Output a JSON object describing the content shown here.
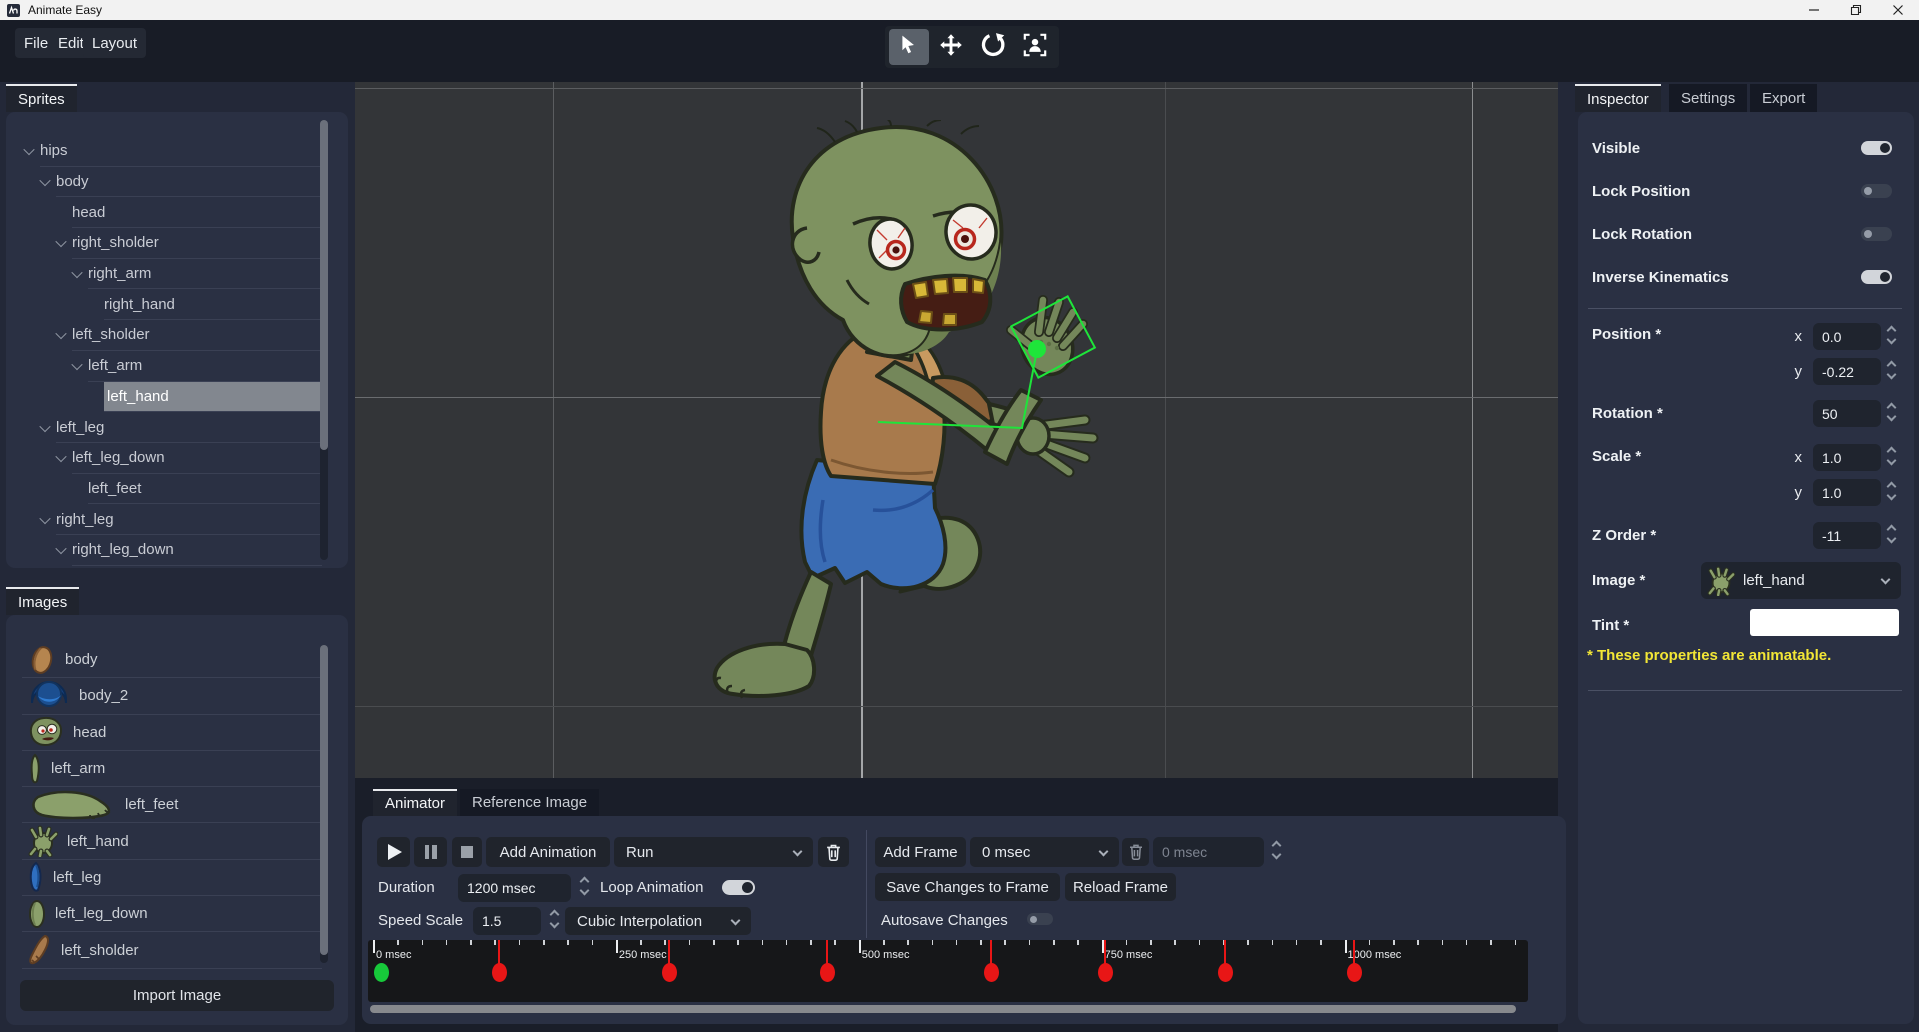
{
  "window": {
    "title": "Animate Easy"
  },
  "menubar": {
    "items": [
      {
        "label": "File"
      },
      {
        "label": "Edit"
      },
      {
        "label": "Layout"
      }
    ]
  },
  "toolbar": {
    "tools": [
      "select-tool",
      "move-tool",
      "rotate-tool",
      "frame-character-tool"
    ],
    "active_tool": "select-tool"
  },
  "sprites_panel": {
    "title": "Sprites",
    "tree": [
      {
        "label": "hips",
        "depth": 0,
        "chevron": true
      },
      {
        "label": "body",
        "depth": 1,
        "chevron": true
      },
      {
        "label": "head",
        "depth": 2,
        "chevron": false
      },
      {
        "label": "right_sholder",
        "depth": 2,
        "chevron": true
      },
      {
        "label": "right_arm",
        "depth": 3,
        "chevron": true
      },
      {
        "label": "right_hand",
        "depth": 4,
        "chevron": false
      },
      {
        "label": "left_sholder",
        "depth": 2,
        "chevron": true
      },
      {
        "label": "left_arm",
        "depth": 3,
        "chevron": true
      },
      {
        "label": "left_hand",
        "depth": 4,
        "chevron": false,
        "selected": true
      },
      {
        "label": "left_leg",
        "depth": 1,
        "chevron": true
      },
      {
        "label": "left_leg_down",
        "depth": 2,
        "chevron": true
      },
      {
        "label": "left_feet",
        "depth": 3,
        "chevron": false
      },
      {
        "label": "right_leg",
        "depth": 1,
        "chevron": true
      },
      {
        "label": "right_leg_down",
        "depth": 2,
        "chevron": true
      }
    ]
  },
  "images_panel": {
    "title": "Images",
    "import_label": "Import Image",
    "items": [
      {
        "label": "body",
        "icon": "body-thumbnail"
      },
      {
        "label": "body_2",
        "icon": "body2-thumbnail"
      },
      {
        "label": "head",
        "icon": "head-thumbnail"
      },
      {
        "label": "left_arm",
        "icon": "left-arm-thumbnail"
      },
      {
        "label": "left_feet",
        "icon": "left-feet-thumbnail"
      },
      {
        "label": "left_hand",
        "icon": "left-hand-thumbnail"
      },
      {
        "label": "left_leg",
        "icon": "left-leg-thumbnail"
      },
      {
        "label": "left_leg_down",
        "icon": "left-leg-down-thumbnail"
      },
      {
        "label": "left_sholder",
        "icon": "left-sholder-thumbnail"
      }
    ]
  },
  "inspector": {
    "tabs": [
      {
        "label": "Inspector"
      },
      {
        "label": "Settings"
      },
      {
        "label": "Export"
      }
    ],
    "active_tab": "Inspector",
    "toggles": [
      {
        "label": "Visible",
        "on": true
      },
      {
        "label": "Lock Position",
        "on": false
      },
      {
        "label": "Lock Rotation",
        "on": false
      },
      {
        "label": "Inverse Kinematics",
        "on": true
      }
    ],
    "position": {
      "label": "Position *",
      "x_label": "x",
      "x": "0.0",
      "y_label": "y",
      "y": "-0.22"
    },
    "rotation": {
      "label": "Rotation *",
      "value": "50"
    },
    "scale": {
      "label": "Scale *",
      "x_label": "x",
      "x": "1.0",
      "y_label": "y",
      "y": "1.0"
    },
    "z_order": {
      "label": "Z Order *",
      "value": "-11"
    },
    "image": {
      "label": "Image *",
      "value": "left_hand"
    },
    "tint": {
      "label": "Tint *",
      "swatch_color": "#ffffff"
    },
    "note": "* These properties are animatable."
  },
  "animator": {
    "tabs": [
      {
        "label": "Animator"
      },
      {
        "label": "Reference Image"
      }
    ],
    "active_tab": "Animator",
    "add_animation": "Add Animation",
    "animation_name": "Run",
    "add_frame": "Add Frame",
    "frame_select": "0 msec",
    "frame_time_placeholder": "0 msec",
    "duration_label": "Duration",
    "duration": "1200 msec",
    "loop_label": "Loop Animation",
    "loop_on": true,
    "speed_label": "Speed Scale",
    "speed": "1.5",
    "interpolation": "Cubic Interpolation",
    "save_frame": "Save Changes to Frame",
    "reload_frame": "Reload Frame",
    "autosave_label": "Autosave Changes",
    "autosave_on": false,
    "timeline": {
      "total_msec": 1200,
      "minor_step_msec": 25,
      "labels": [
        {
          "text": "0 msec",
          "msec": 0
        },
        {
          "text": "250 msec",
          "msec": 250
        },
        {
          "text": "500 msec",
          "msec": 500
        },
        {
          "text": "750 msec",
          "msec": 750
        },
        {
          "text": "1000 msec",
          "msec": 1000
        }
      ],
      "keyframes_msec": [
        130,
        305,
        467,
        636,
        753,
        877,
        1010
      ],
      "playhead_msec": 0,
      "keyframe_color": "#e81616",
      "playhead_color": "#17c93a"
    }
  },
  "colors": {
    "selection_green": "#1ee53a",
    "note_yellow": "#f2e636"
  }
}
